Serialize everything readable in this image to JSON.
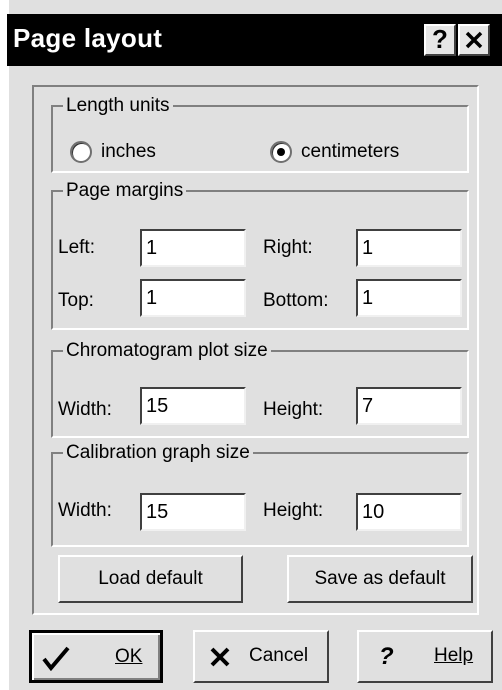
{
  "window": {
    "title": "Page layout",
    "help_glyph": "?",
    "close_glyph": "✕"
  },
  "length_units": {
    "legend": "Length units",
    "options": [
      {
        "label": "inches",
        "selected": false
      },
      {
        "label": "centimeters",
        "selected": true
      }
    ]
  },
  "page_margins": {
    "legend": "Page margins",
    "left_label": "Left:",
    "left_value": "1",
    "right_label": "Right:",
    "right_value": "1",
    "top_label": "Top:",
    "top_value": "1",
    "bottom_label": "Bottom:",
    "bottom_value": "1"
  },
  "chromatogram": {
    "legend": "Chromatogram plot size",
    "width_label": "Width:",
    "width_value": "15",
    "height_label": "Height:",
    "height_value": "7"
  },
  "calibration": {
    "legend": "Calibration graph size",
    "width_label": "Width:",
    "width_value": "15",
    "height_label": "Height:",
    "height_value": "10"
  },
  "buttons": {
    "load_default": "Load default",
    "save_as_default": "Save as default",
    "ok": "OK",
    "cancel": "Cancel",
    "help": "Help",
    "help_glyph": "?"
  },
  "icons": {
    "ok": "checkmark-icon",
    "cancel": "x-icon",
    "help": "question-mark-icon"
  }
}
